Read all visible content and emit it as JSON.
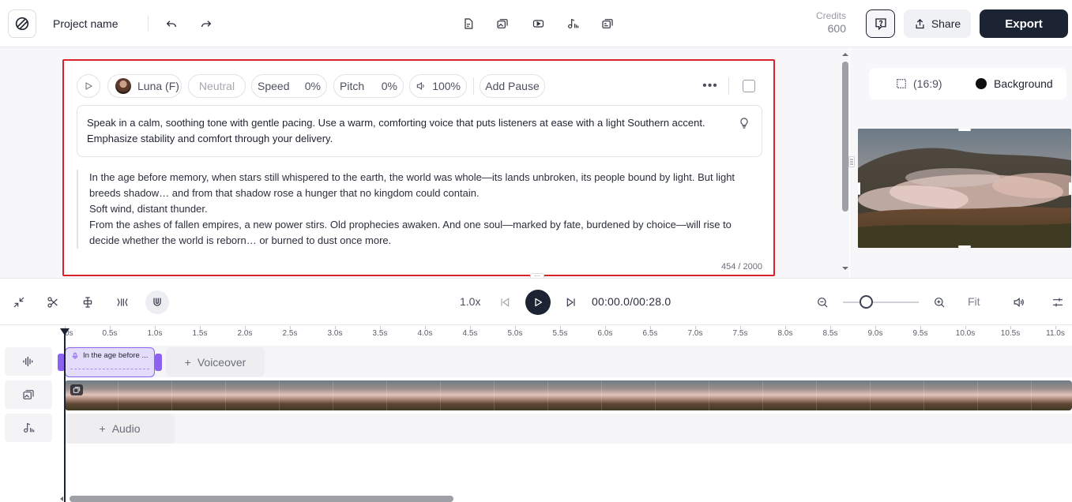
{
  "header": {
    "project_name": "Project name",
    "credits_label": "Credits",
    "credits_value": "600",
    "share_label": "Share",
    "export_label": "Export"
  },
  "voice_settings": {
    "voice_name": "Luna (F)",
    "emotion": "Neutral",
    "speed_label": "Speed",
    "speed_value": "0%",
    "pitch_label": "Pitch",
    "pitch_value": "0%",
    "volume_value": "100%",
    "add_pause_label": "Add Pause"
  },
  "instruction_text": "Speak in a calm, soothing tone with gentle pacing. Use a warm, comforting voice that puts listeners at ease with a light Southern accent. Emphasize stability and comfort through your delivery.",
  "script_lines": [
    "In the age before memory, when stars still whispered to the earth, the world was whole—its lands unbroken, its people bound by light. But light breeds shadow… and from that shadow rose a hunger that no kingdom could contain.",
    "Soft wind, distant thunder.",
    "From the ashes of fallen empires, a new power stirs. Old prophecies awaken. And one soul—marked by fate, burdened by choice—will rise to decide whether the world is reborn… or burned to dust once more."
  ],
  "char_count": "454 / 2000",
  "preview": {
    "aspect_ratio": "(16:9)",
    "background_label": "Background"
  },
  "playback": {
    "speed": "1.0x",
    "timecode": "00:00.0/00:28.0",
    "fit_label": "Fit",
    "zoom_level": 0.25
  },
  "ruler_labels": [
    "0s",
    "0.5s",
    "1.0s",
    "1.5s",
    "2.0s",
    "2.5s",
    "3.0s",
    "3.5s",
    "4.0s",
    "4.5s",
    "5.0s",
    "5.5s",
    "6.0s",
    "6.5s",
    "7.0s",
    "7.5s",
    "8.0s",
    "8.5s",
    "9.0s",
    "9.5s",
    "10.0s",
    "10.5s",
    "11.0s"
  ],
  "tracks": {
    "voiceover_clip_text": "In the age before ...",
    "add_voiceover_label": "Voiceover",
    "add_audio_label": "Audio"
  },
  "colors": {
    "accent_purple": "#8b63f0",
    "dark": "#1c2433",
    "highlight_red": "#d8232a"
  }
}
